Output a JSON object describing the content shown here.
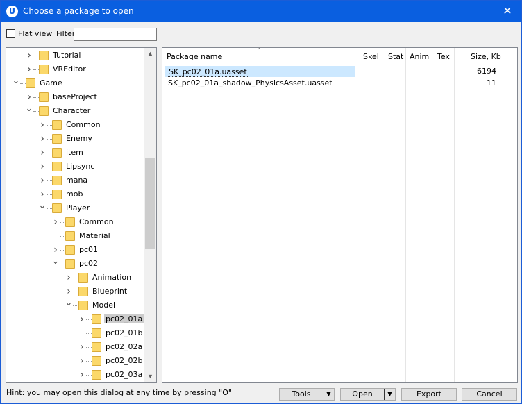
{
  "window": {
    "title": "Choose a package to open",
    "app_icon": "U",
    "close_glyph": "✕"
  },
  "toolbar": {
    "flat_view_label": "Flat view",
    "flat_view_checked": false,
    "filter_label": "Filter:",
    "filter_value": ""
  },
  "tree": {
    "items": [
      {
        "label": "Tutorial",
        "level": 2,
        "expander": ">",
        "selected": false
      },
      {
        "label": "VREditor",
        "level": 2,
        "expander": ">",
        "selected": false
      },
      {
        "label": "Game",
        "level": 1,
        "expander": "v",
        "selected": false
      },
      {
        "label": "baseProject",
        "level": 2,
        "expander": ">",
        "selected": false
      },
      {
        "label": "Character",
        "level": 2,
        "expander": "v",
        "selected": false
      },
      {
        "label": "Common",
        "level": 3,
        "expander": ">",
        "selected": false
      },
      {
        "label": "Enemy",
        "level": 3,
        "expander": ">",
        "selected": false
      },
      {
        "label": "item",
        "level": 3,
        "expander": ">",
        "selected": false
      },
      {
        "label": "Lipsync",
        "level": 3,
        "expander": ">",
        "selected": false
      },
      {
        "label": "mana",
        "level": 3,
        "expander": ">",
        "selected": false
      },
      {
        "label": "mob",
        "level": 3,
        "expander": ">",
        "selected": false
      },
      {
        "label": "Player",
        "level": 3,
        "expander": "v",
        "selected": false
      },
      {
        "label": "Common",
        "level": 4,
        "expander": ">",
        "selected": false
      },
      {
        "label": "Material",
        "level": 4,
        "expander": "",
        "selected": false
      },
      {
        "label": "pc01",
        "level": 4,
        "expander": ">",
        "selected": false
      },
      {
        "label": "pc02",
        "level": 4,
        "expander": "v",
        "selected": false
      },
      {
        "label": "Animation",
        "level": 5,
        "expander": ">",
        "selected": false
      },
      {
        "label": "Blueprint",
        "level": 5,
        "expander": ">",
        "selected": false
      },
      {
        "label": "Model",
        "level": 5,
        "expander": "v",
        "selected": false
      },
      {
        "label": "pc02_01a",
        "level": 6,
        "expander": ">",
        "selected": true
      },
      {
        "label": "pc02_01b",
        "level": 6,
        "expander": "",
        "selected": false
      },
      {
        "label": "pc02_02a",
        "level": 6,
        "expander": ">",
        "selected": false
      },
      {
        "label": "pc02_02b",
        "level": 6,
        "expander": ">",
        "selected": false
      },
      {
        "label": "pc02_03a",
        "level": 6,
        "expander": ">",
        "selected": false
      }
    ]
  },
  "list": {
    "columns": [
      "Package name",
      "Skel",
      "Stat",
      "Anim",
      "Tex",
      "Size, Kb"
    ],
    "rows": [
      {
        "name": "SK_pc02_01a.uasset",
        "size": "6194",
        "selected": true
      },
      {
        "name": "SK_pc02_01a_shadow_PhysicsAsset.uasset",
        "size": "11",
        "selected": false
      }
    ]
  },
  "footer": {
    "hint": "Hint: you may open this dialog at any time by pressing \"O\"",
    "tools_label": "Tools",
    "open_label": "Open",
    "export_label": "Export",
    "cancel_label": "Cancel",
    "dropdown_glyph": "▼"
  },
  "colors": {
    "titlebar": "#0a5fe0",
    "selection": "#cce8ff",
    "folder": "#fbd86a"
  }
}
